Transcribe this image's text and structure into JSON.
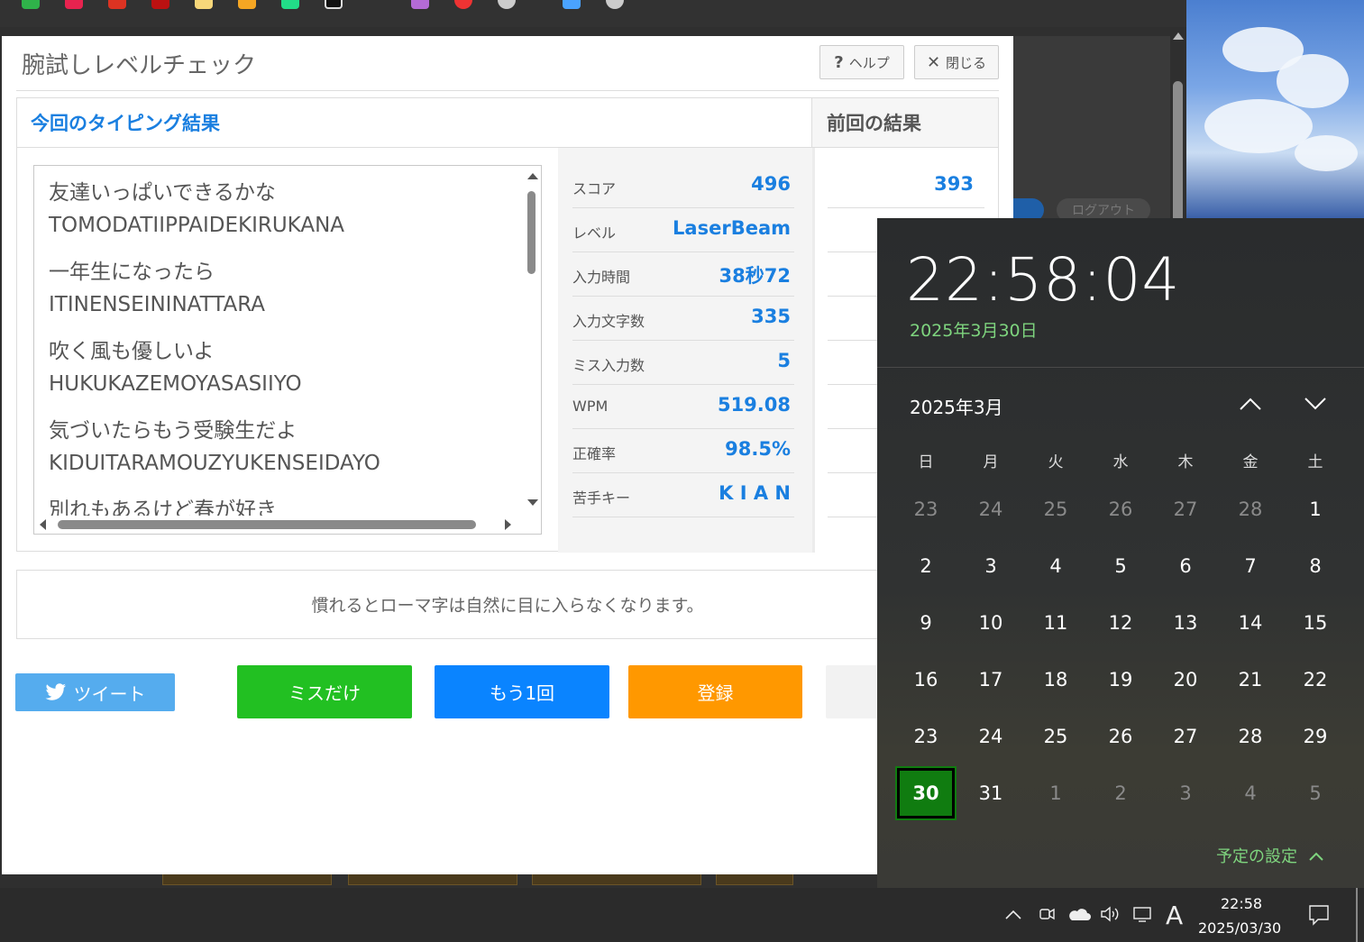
{
  "dialog": {
    "title": "腕試しレベルチェック",
    "help_label": "ヘルプ",
    "close_label": "閉じる",
    "current_header": "今回のタイピング結果",
    "previous_header": "前回の結果"
  },
  "lyrics": [
    {
      "jp": "友達いっぱいできるかな",
      "romaji": "TOMODATIIPPAIDEKIRUKANA"
    },
    {
      "jp": "一年生になったら",
      "romaji": "ITINENSEININATTARA"
    },
    {
      "jp": "吹く風も優しいよ",
      "romaji": "HUKUKAZEMOYASASIIYO"
    },
    {
      "jp": "気づいたらもう受験生だよ",
      "romaji": "KIDUITARAMOUZYUKENSEIDAYO"
    },
    {
      "jp": "別れもあるけど春が好き",
      "romaji": ""
    }
  ],
  "stats": [
    {
      "label": "スコア",
      "value": "496"
    },
    {
      "label": "レベル",
      "value": "LaserBeam"
    },
    {
      "label": "入力時間",
      "value": "38秒72"
    },
    {
      "label": "入力文字数",
      "value": "335"
    },
    {
      "label": "ミス入力数",
      "value": "5"
    },
    {
      "label": "WPM",
      "value": "519.08"
    },
    {
      "label": "正確率",
      "value": "98.5%"
    },
    {
      "label": "苦手キー",
      "value": "K I A N"
    }
  ],
  "previous": {
    "score": "393"
  },
  "tip": "慣れるとローマ字は自然に目に入らなくなります。",
  "actions": {
    "tweet": "ツイート",
    "miss_only": "ミスだけ",
    "retry": "もう1回",
    "register": "登録"
  },
  "background": {
    "logout": "ログアウト"
  },
  "calendar": {
    "time": "22:58:04",
    "date": "2025年3月30日",
    "month": "2025年3月",
    "weekdays": [
      "日",
      "月",
      "火",
      "水",
      "木",
      "金",
      "土"
    ],
    "rows": [
      [
        "23",
        "24",
        "25",
        "26",
        "27",
        "28",
        "1"
      ],
      [
        "2",
        "3",
        "4",
        "5",
        "6",
        "7",
        "8"
      ],
      [
        "9",
        "10",
        "11",
        "12",
        "13",
        "14",
        "15"
      ],
      [
        "16",
        "17",
        "18",
        "19",
        "20",
        "21",
        "22"
      ],
      [
        "23",
        "24",
        "25",
        "26",
        "27",
        "28",
        "29"
      ],
      [
        "30",
        "31",
        "1",
        "2",
        "3",
        "4",
        "5"
      ]
    ],
    "today": "30",
    "schedule": "予定の設定"
  },
  "taskbar": {
    "ime": "A",
    "time": "22:58",
    "date": "2025/03/30"
  },
  "colors": {
    "accent_blue": "#1a7fe0",
    "tweet": "#55acee",
    "miss_only": "#22c022",
    "retry": "#0a84ff",
    "register": "#ff9800",
    "today_green": "#107c10"
  }
}
